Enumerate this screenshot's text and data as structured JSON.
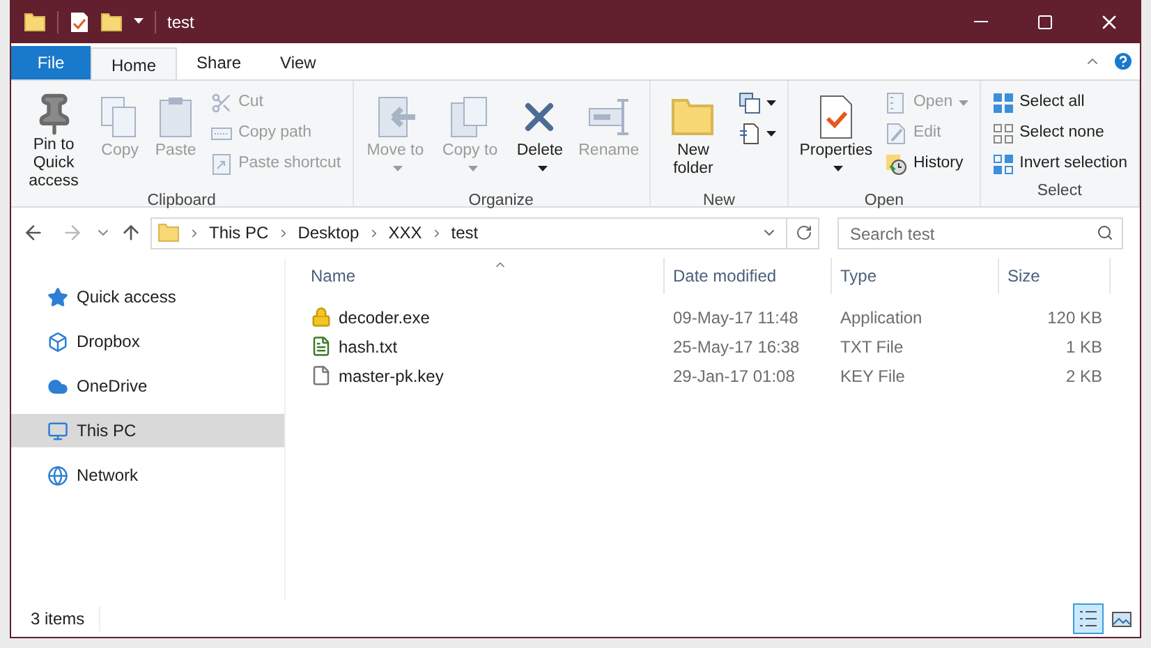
{
  "window": {
    "title": "test"
  },
  "tabs": [
    {
      "label": "File",
      "kind": "file",
      "selected": false
    },
    {
      "label": "Home",
      "kind": "tab",
      "selected": true
    },
    {
      "label": "Share",
      "kind": "tab",
      "selected": false
    },
    {
      "label": "View",
      "kind": "tab",
      "selected": false
    }
  ],
  "ribbon": [
    {
      "name": "Clipboard",
      "items": [
        {
          "kind": "big",
          "label": "Pin to Quick access",
          "disabled": false,
          "dropdown": false
        },
        {
          "kind": "big",
          "label": "Copy",
          "disabled": true,
          "dropdown": false
        },
        {
          "kind": "big",
          "label": "Paste",
          "disabled": true,
          "dropdown": false
        },
        {
          "kind": "stack",
          "items": [
            {
              "label": "Cut",
              "disabled": true,
              "dropdown": false
            },
            {
              "label": "Copy path",
              "disabled": true,
              "dropdown": false
            },
            {
              "label": "Paste shortcut",
              "disabled": true,
              "dropdown": false
            }
          ]
        }
      ]
    },
    {
      "name": "Organize",
      "items": [
        {
          "kind": "big",
          "label": "Move to",
          "disabled": true,
          "dropdown": true
        },
        {
          "kind": "big",
          "label": "Copy to",
          "disabled": true,
          "dropdown": true
        },
        {
          "kind": "big",
          "label": "Delete",
          "disabled": false,
          "dropdown": true
        },
        {
          "kind": "big",
          "label": "Rename",
          "disabled": true,
          "dropdown": false
        }
      ]
    },
    {
      "name": "New",
      "items": [
        {
          "kind": "big",
          "label": "New folder",
          "disabled": false,
          "dropdown": false
        },
        {
          "kind": "stack",
          "items": [
            {
              "disabled": false,
              "dropdown": true
            },
            {
              "disabled": false,
              "dropdown": true
            }
          ]
        }
      ]
    },
    {
      "name": "Open",
      "items": [
        {
          "kind": "big",
          "label": "Properties",
          "disabled": false,
          "dropdown": true
        },
        {
          "kind": "stack",
          "items": [
            {
              "label": "Open",
              "disabled": true,
              "dropdown": true
            },
            {
              "label": "Edit",
              "disabled": true,
              "dropdown": false
            },
            {
              "label": "History",
              "disabled": false,
              "dropdown": false
            }
          ]
        }
      ]
    },
    {
      "name": "Select",
      "items": [
        {
          "kind": "stack",
          "items": [
            {
              "label": "Select all",
              "disabled": false,
              "dropdown": false
            },
            {
              "label": "Select none",
              "disabled": false,
              "dropdown": false
            },
            {
              "label": "Invert selection",
              "disabled": false,
              "dropdown": false
            }
          ]
        }
      ]
    }
  ],
  "address": {
    "path": [
      "This PC",
      "Desktop",
      "XXX",
      "test"
    ]
  },
  "search": {
    "placeholder": "Search test"
  },
  "sidebar": {
    "items": [
      {
        "label": "Quick access",
        "selected": false
      },
      {
        "label": "Dropbox",
        "selected": false
      },
      {
        "label": "OneDrive",
        "selected": false
      },
      {
        "label": "This PC",
        "selected": true
      },
      {
        "label": "Network",
        "selected": false
      }
    ]
  },
  "table": {
    "columns": [
      "Name",
      "Date modified",
      "Type",
      "Size"
    ],
    "rows": [
      {
        "name": "decoder.exe",
        "date": "09-May-17 11:48",
        "type": "Application",
        "size": "120 KB"
      },
      {
        "name": "hash.txt",
        "date": "25-May-17 16:38",
        "type": "TXT File",
        "size": "1 KB"
      },
      {
        "name": "master-pk.key",
        "date": "29-Jan-17 01:08",
        "type": "KEY File",
        "size": "2 KB"
      }
    ]
  },
  "status_bar": {
    "count": "3 items",
    "views": [
      {
        "kind": "details",
        "selected": true
      },
      {
        "kind": "thumbnails",
        "selected": false
      }
    ]
  }
}
